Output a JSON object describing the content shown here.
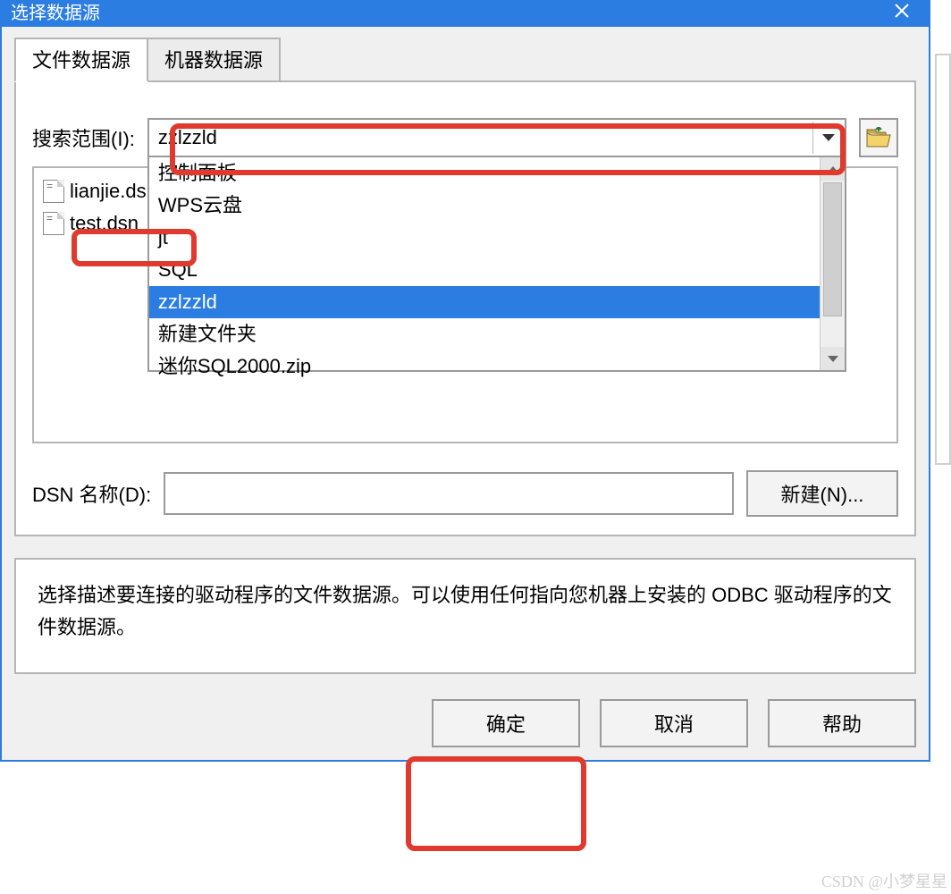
{
  "title": "选择数据源",
  "tabs": {
    "file": "文件数据源",
    "machine": "机器数据源"
  },
  "search": {
    "label": "搜索范围(I):",
    "value": "zzlzzld",
    "options": [
      "控制面板",
      "WPS云盘",
      "jt",
      "SQL",
      "zzlzzld",
      "新建文件夹",
      "迷你SQL2000.zip"
    ],
    "selected_index": 4
  },
  "files": [
    "lianjie.dsn",
    "test.dsn"
  ],
  "dsn": {
    "label": "DSN 名称(D):",
    "value": "",
    "new_btn": "新建(N)..."
  },
  "description": "选择描述要连接的驱动程序的文件数据源。可以使用任何指向您机器上安装的 ODBC 驱动程序的文件数据源。",
  "buttons": {
    "ok": "确定",
    "cancel": "取消",
    "help": "帮助"
  },
  "watermark": "CSDN @小梦星星"
}
